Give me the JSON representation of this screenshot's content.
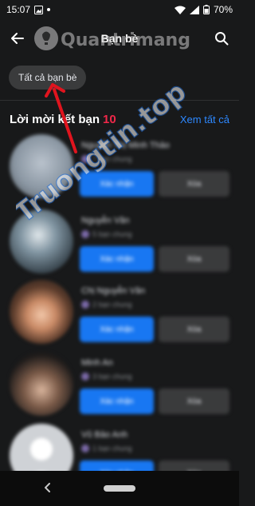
{
  "status_bar": {
    "time": "15:07",
    "battery": "70%"
  },
  "header": {
    "title": "Bạn bè"
  },
  "filter_chip": {
    "label": "Tất cả bạn bè"
  },
  "requests": {
    "title": "Lời mời kết bạn",
    "count": "10",
    "see_all": "Xem tất cả",
    "items": [
      {
        "name": "Nguyễn Thị Minh Thảo",
        "mutual": "7 bạn chung",
        "accept": "Xác nhận",
        "delete": "Xóa"
      },
      {
        "name": "Nguyễn Văn",
        "mutual": "5 bạn chung",
        "accept": "Xác nhận",
        "delete": "Xóa"
      },
      {
        "name": "Chị Nguyễn Văn",
        "mutual": "2 bạn chung",
        "accept": "Xác nhận",
        "delete": "Xóa"
      },
      {
        "name": "Minh An",
        "mutual": "3 bạn chung",
        "accept": "Xác nhận",
        "delete": "Xóa"
      },
      {
        "name": "Vũ Bảo Anh",
        "mutual": "1 bạn chung",
        "accept": "Xác nhận",
        "delete": "Xóa"
      }
    ]
  },
  "watermark": {
    "logo": "Quantrimang",
    "diagonal": "Truongtin.top"
  },
  "colors": {
    "accent": "#2d88ff",
    "count_red": "#f02849",
    "annotation": "#e0141e"
  },
  "icons": {
    "back": "arrow-left-icon",
    "search": "search-icon",
    "nav_back": "nav-back-icon",
    "nav_home": "nav-home-pill"
  }
}
